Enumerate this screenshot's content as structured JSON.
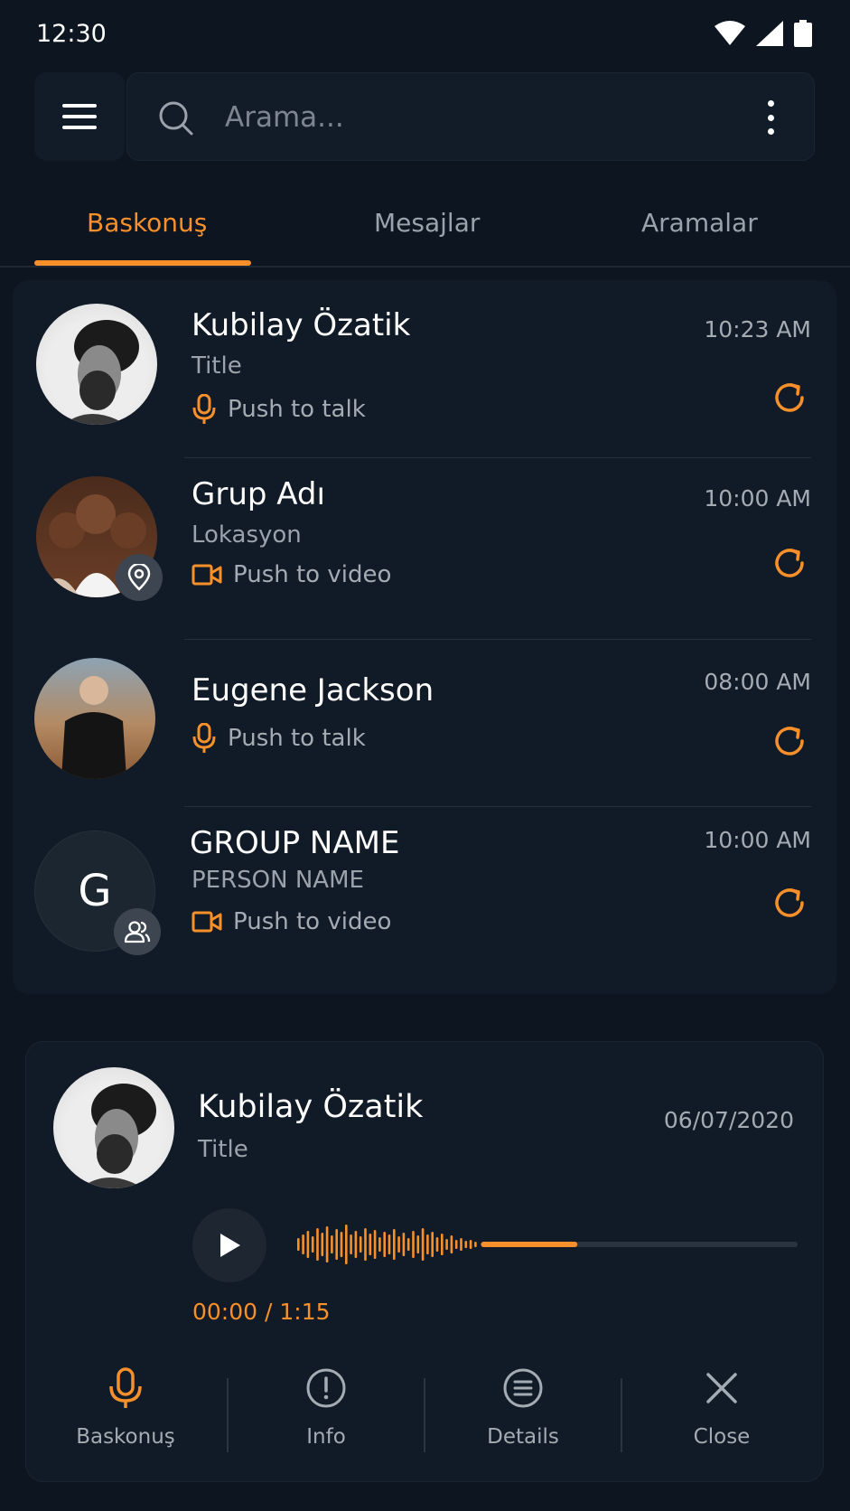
{
  "status_bar": {
    "time": "12:30"
  },
  "search": {
    "placeholder": "Arama..."
  },
  "tabs": [
    {
      "label": "Baskonuş",
      "active": true
    },
    {
      "label": "Mesajlar",
      "active": false
    },
    {
      "label": "Aramalar",
      "active": false
    }
  ],
  "conversations": [
    {
      "name": "Kubilay Özatik",
      "subtitle": "Title",
      "action": "Push to talk",
      "action_icon": "mic-icon",
      "time": "10:23 AM"
    },
    {
      "name": "Grup Adı",
      "subtitle": "Lokasyon",
      "action": "Push to video",
      "action_icon": "video-icon",
      "time": "10:00 AM",
      "badge_icon": "location-pin-icon"
    },
    {
      "name": "Eugene Jackson",
      "action": "Push to talk",
      "action_icon": "mic-icon",
      "time": "08:00 AM"
    },
    {
      "name": "GROUP NAME",
      "subtitle": "PERSON NAME",
      "action": "Push to video",
      "action_icon": "video-icon",
      "time": "10:00 AM",
      "avatar_initial": "G",
      "badge_icon": "group-icon"
    }
  ],
  "player": {
    "name": "Kubilay Özatik",
    "subtitle": "Title",
    "date": "06/07/2020",
    "time_display": "00:00 / 1:15",
    "progress": 0.56,
    "actions": [
      {
        "label": "Baskonuş",
        "icon": "mic-icon"
      },
      {
        "label": "Info",
        "icon": "info-icon"
      },
      {
        "label": "Details",
        "icon": "list-icon"
      },
      {
        "label": "Close",
        "icon": "close-icon"
      }
    ]
  },
  "colors": {
    "accent": "#f7902a",
    "background": "#0d1520",
    "card": "#111b27"
  }
}
